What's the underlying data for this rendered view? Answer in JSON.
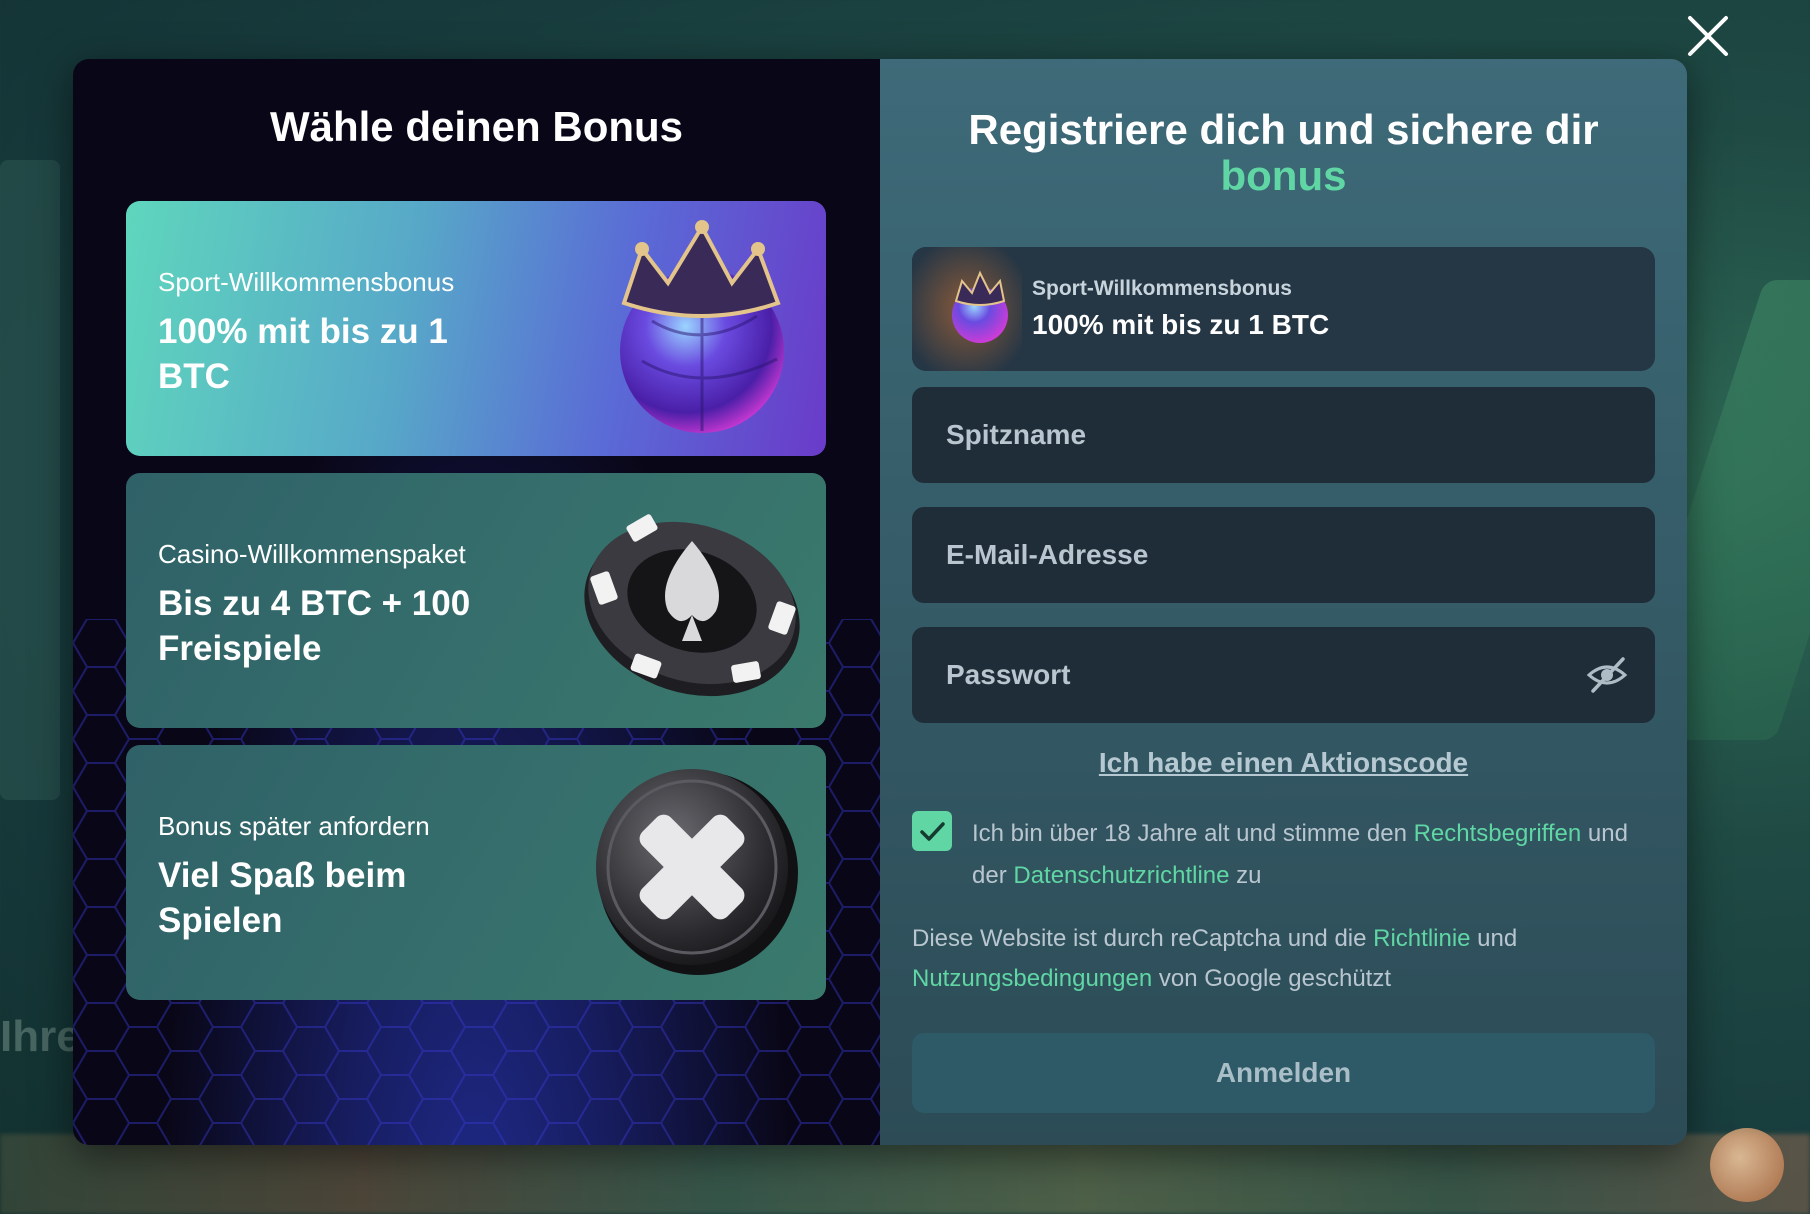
{
  "left": {
    "title": "Wähle deinen Bonus",
    "cards": [
      {
        "subtitle": "Sport-Willkommensbonus",
        "main": "100% mit bis zu 1 BTC",
        "icon": "crowned-ball-icon",
        "selected": true
      },
      {
        "subtitle": "Casino-Willkommenspaket",
        "main": "Bis zu 4 BTC + 100 Freispiele",
        "icon": "poker-chip-spade-icon",
        "selected": false
      },
      {
        "subtitle": "Bonus später anfordern",
        "main": "Viel Spaß beim Spielen",
        "icon": "cancel-coin-icon",
        "selected": false
      }
    ]
  },
  "right": {
    "title": "Registriere dich und sichere dir",
    "title_accent": "bonus",
    "selected_bonus": {
      "subtitle": "Sport-Willkommensbonus",
      "main": "100% mit bis zu 1 BTC"
    },
    "fields": {
      "nickname_placeholder": "Spitzname",
      "email_placeholder": "E-Mail-Adresse",
      "password_placeholder": "Passwort"
    },
    "promo_link": "Ich habe einen Aktionscode",
    "terms": {
      "checked": true,
      "text_1": "Ich bin über 18 Jahre alt und stimme den ",
      "link_1": "Rechtsbegriffen",
      "text_2": " und der ",
      "link_2": "Datenschutzrichtline",
      "text_3": " zu"
    },
    "captcha": {
      "text_1": "Diese Website ist durch reCaptcha und die ",
      "link_1": "Richtlinie",
      "text_2": " und ",
      "link_2": "Nutzungsbedingungen",
      "text_3": " von Google geschützt"
    },
    "submit_label": "Anmelden"
  },
  "background": {
    "left_text": "Ihre"
  },
  "colors": {
    "accent": "#5fd6a4",
    "left_panel_bg": "#090717",
    "right_panel_bg": "#3e6a79",
    "field_bg": "#1f2d38"
  }
}
